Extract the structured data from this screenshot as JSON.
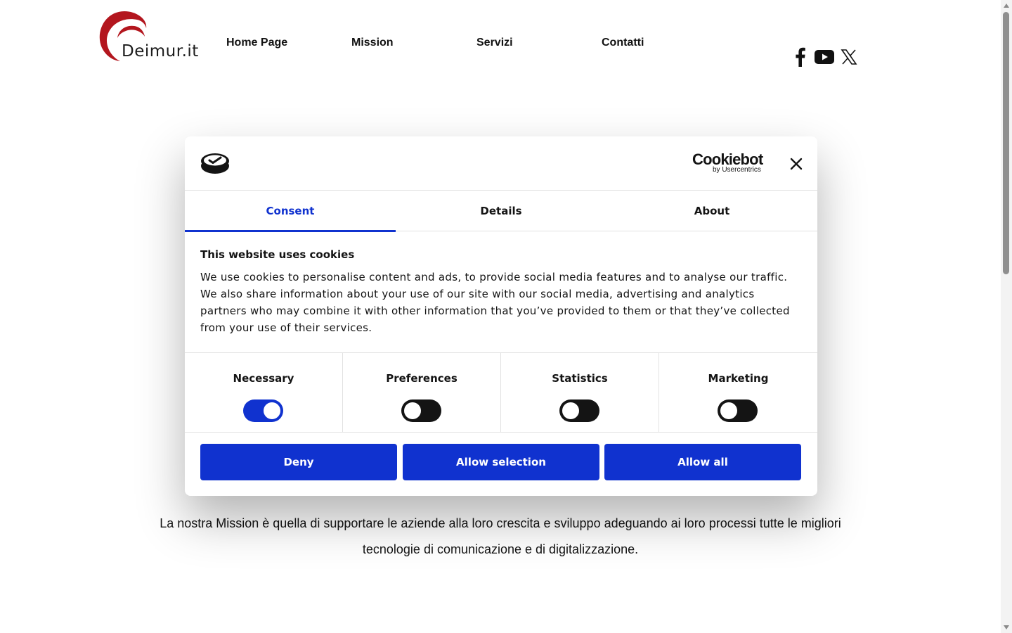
{
  "site": {
    "logo_text": "Deimur.it",
    "nav": [
      {
        "label": "Home Page"
      },
      {
        "label": "Mission"
      },
      {
        "label": "Servizi"
      },
      {
        "label": "Contatti"
      }
    ],
    "social_icons": [
      "facebook-icon",
      "youtube-icon",
      "x-icon"
    ]
  },
  "mission": {
    "text": "La nostra Mission è quella di supportare le aziende alla loro crescita e sviluppo adeguando ai loro processi tutte le migliori tecnologie di comunicazione e di digitalizzazione."
  },
  "cookie_dialog": {
    "brand_main": "Cookiebot",
    "brand_sub": "by Usercentrics",
    "tabs": [
      {
        "label": "Consent",
        "active": true
      },
      {
        "label": "Details",
        "active": false
      },
      {
        "label": "About",
        "active": false
      }
    ],
    "title": "This website uses cookies",
    "body": "We use cookies to personalise content and ads, to provide social media features and to analyse our traffic. We also share information about your use of our site with our social media, advertising and analytics partners who may combine it with other information that you’ve provided to them or that they’ve collected from your use of their services.",
    "toggles": [
      {
        "label": "Necessary",
        "on": true
      },
      {
        "label": "Preferences",
        "on": false
      },
      {
        "label": "Statistics",
        "on": false
      },
      {
        "label": "Marketing",
        "on": false
      }
    ],
    "buttons": {
      "deny": "Deny",
      "allow_selection": "Allow selection",
      "allow_all": "Allow all"
    }
  },
  "colors": {
    "accent": "#1032cf",
    "logo_red": "#b3161e",
    "toggle_off": "#141414",
    "text": "#141414"
  }
}
